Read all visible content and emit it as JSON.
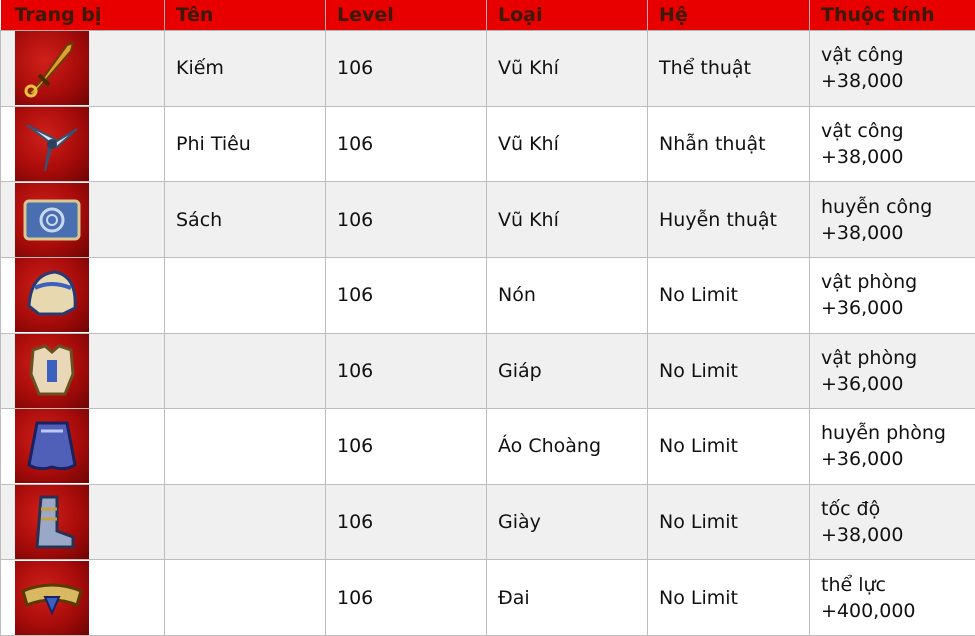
{
  "headers": [
    "Trang bị",
    "Tên",
    "Level",
    "Loại",
    "Hệ",
    "Thuộc tính"
  ],
  "colors": {
    "header_bg": "#e80000",
    "header_text": "#3a1a00",
    "row_alt": "#f0f0f0"
  },
  "rows": [
    {
      "icon": "dagger-icon",
      "name": "Kiếm",
      "level": "106",
      "type": "Vũ Khí",
      "school": "Thể thuật",
      "attr_name": "vật công",
      "attr_value": "+38,000"
    },
    {
      "icon": "shuriken-icon",
      "name": "Phi Tiêu",
      "level": "106",
      "type": "Vũ Khí",
      "school": "Nhẫn thuật",
      "attr_name": "vật công",
      "attr_value": "+38,000"
    },
    {
      "icon": "scroll-icon",
      "name": "Sách",
      "level": "106",
      "type": "Vũ Khí",
      "school": "Huyễn thuật",
      "attr_name": "huyễn công",
      "attr_value": "+38,000"
    },
    {
      "icon": "helmet-icon",
      "name": "",
      "level": "106",
      "type": "Nón",
      "school": "No Limit",
      "attr_name": "vật phòng",
      "attr_value": "+36,000"
    },
    {
      "icon": "armor-icon",
      "name": "",
      "level": "106",
      "type": "Giáp",
      "school": "No Limit",
      "attr_name": "vật phòng",
      "attr_value": "+36,000"
    },
    {
      "icon": "cloak-icon",
      "name": "",
      "level": "106",
      "type": "Áo Choàng",
      "school": "No Limit",
      "attr_name": "huyễn phòng",
      "attr_value": "+36,000"
    },
    {
      "icon": "boots-icon",
      "name": "",
      "level": "106",
      "type": "Giày",
      "school": "No Limit",
      "attr_name": "tốc độ",
      "attr_value": "+38,000"
    },
    {
      "icon": "belt-icon",
      "name": "",
      "level": "106",
      "type": "Đai",
      "school": "No Limit",
      "attr_name": "thể lực",
      "attr_value": "+400,000"
    }
  ]
}
